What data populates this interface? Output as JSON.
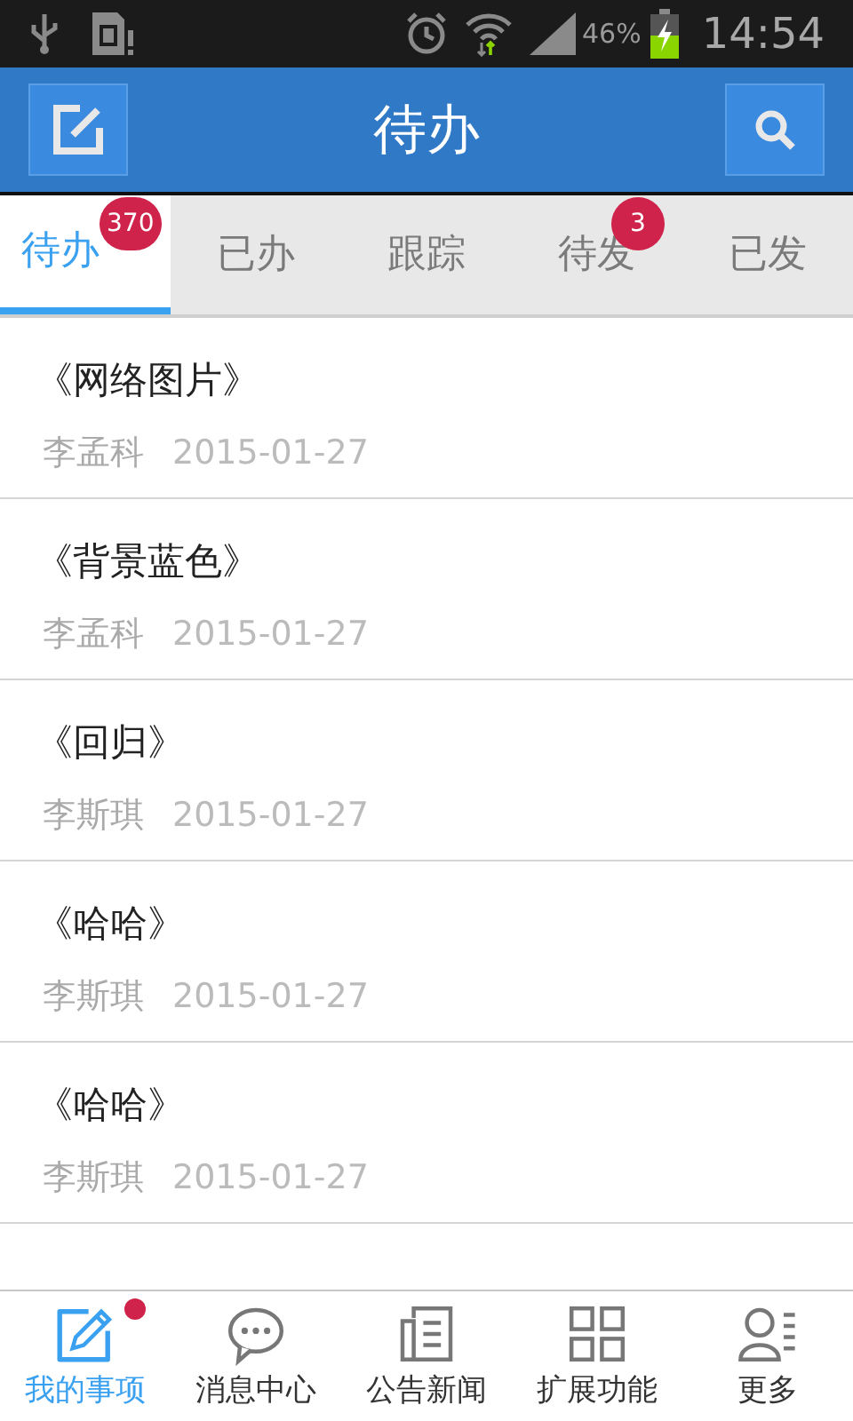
{
  "status_bar": {
    "battery": "46%",
    "time": "14:54"
  },
  "header": {
    "title": "待办"
  },
  "tabs": [
    {
      "label": "待办",
      "selected": true,
      "badge": "370"
    },
    {
      "label": "已办",
      "selected": false
    },
    {
      "label": "跟踪",
      "selected": false
    },
    {
      "label": "待发",
      "selected": false,
      "badge": "3"
    },
    {
      "label": "已发",
      "selected": false
    }
  ],
  "items": [
    {
      "title": "《网络图片》",
      "author": "李孟科",
      "date": "2015-01-27"
    },
    {
      "title": "《背景蓝色》",
      "author": "李孟科",
      "date": "2015-01-27"
    },
    {
      "title": "《回归》",
      "author": "李斯琪",
      "date": "2015-01-27"
    },
    {
      "title": "《哈哈》",
      "author": "李斯琪",
      "date": "2015-01-27"
    },
    {
      "title": "《哈哈》",
      "author": "李斯琪",
      "date": "2015-01-27"
    }
  ],
  "bottom_nav": [
    {
      "label": "我的事项",
      "selected": true,
      "dot": true
    },
    {
      "label": "消息中心",
      "selected": false,
      "dot": false
    },
    {
      "label": "公告新闻",
      "selected": false,
      "dot": false
    },
    {
      "label": "扩展功能",
      "selected": false,
      "dot": false
    },
    {
      "label": "更多",
      "selected": false,
      "dot": false
    }
  ]
}
